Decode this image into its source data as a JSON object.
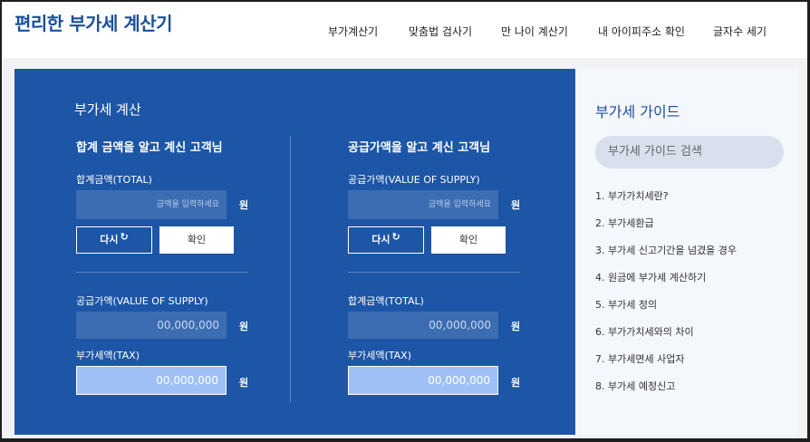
{
  "brand": "편리한 부가세 계산기",
  "nav": [
    "부가계산기",
    "맞춤법 검사기",
    "만 나이 계산기",
    "내 아이피주소 확인",
    "글자수 세기"
  ],
  "calc": {
    "title": "부가세 계산",
    "left": {
      "subtitle": "합계 금액을 알고 계신 고객님",
      "input_label": "합계금액(TOTAL)",
      "input_placeholder": "금액을 입력하세요",
      "unit": "원",
      "reset_label": "다시",
      "ok_label": "확인",
      "out1_label": "공급가액(VALUE OF SUPPLY)",
      "out1_value": "00,000,000",
      "out2_label": "부가세액(TAX)",
      "out2_value": "00,000,000"
    },
    "right": {
      "subtitle": "공급가액을 알고 계신 고객님",
      "input_label": "공급가액(VALUE OF SUPPLY)",
      "input_placeholder": "금액을 입력하세요",
      "unit": "원",
      "reset_label": "다시",
      "ok_label": "확인",
      "out1_label": "합계금액(TOTAL)",
      "out1_value": "00,000,000",
      "out2_label": "부가세액(TAX)",
      "out2_value": "00,000,000"
    },
    "refresh_icon": "refresh-icon"
  },
  "guide": {
    "title": "부가세 가이드",
    "search_placeholder": "부가세 가이드 검색",
    "items": [
      "1. 부가가치세란?",
      "2. 부가세환급",
      "3. 부가세 신고기간을 넘겼을 경우",
      "4. 원금에 부가세 계산하기",
      "5. 부가세 정의",
      "6. 부가가치세와의 차이",
      "7. 부가세면세 사업자",
      "8. 부가세 예정신고"
    ]
  },
  "colors": {
    "brand": "#1b4f9c",
    "panel": "#1d56a6",
    "field": "#3c6db3",
    "tax_field": "#9ec0f5"
  }
}
